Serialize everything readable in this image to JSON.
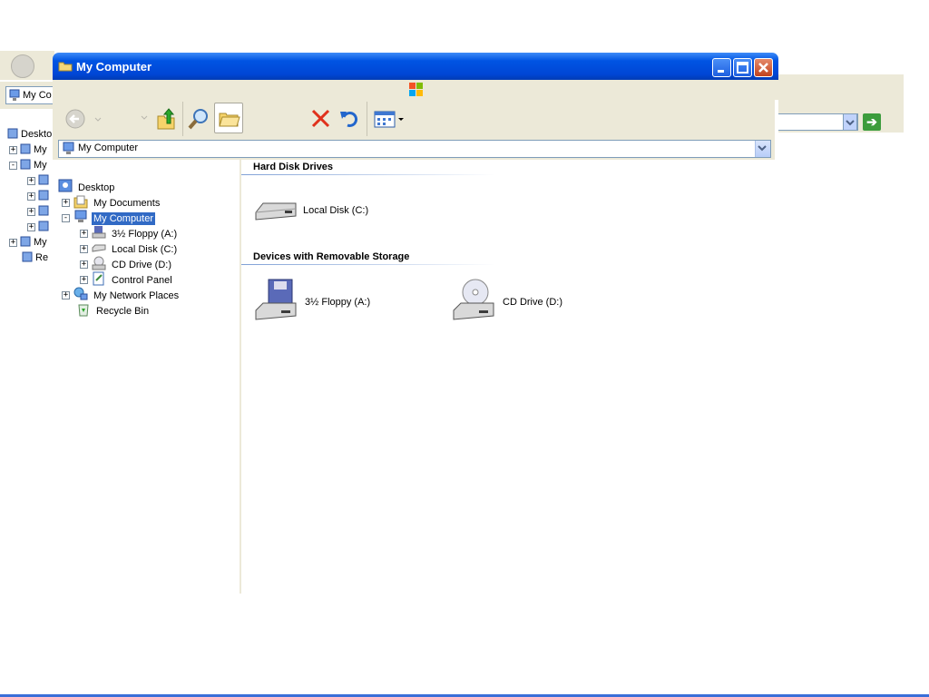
{
  "window": {
    "title": "My Computer",
    "address": "My Computer"
  },
  "ghost": {
    "address_text": "My Co",
    "tree": [
      {
        "label": "Deskto",
        "expander": ""
      },
      {
        "label": "My",
        "expander": "+"
      },
      {
        "label": "My",
        "expander": "-"
      },
      {
        "label": "",
        "expander": "+"
      },
      {
        "label": "",
        "expander": "+"
      },
      {
        "label": "",
        "expander": "+"
      },
      {
        "label": "",
        "expander": "+"
      },
      {
        "label": "My",
        "expander": "+"
      },
      {
        "label": "Re",
        "expander": ""
      }
    ]
  },
  "tree": {
    "desktop": "Desktop",
    "my_documents": "My Documents",
    "my_computer": "My Computer",
    "floppy": "3½ Floppy (A:)",
    "local_disk": "Local Disk (C:)",
    "cd_drive": "CD Drive (D:)",
    "control_panel": "Control Panel",
    "network": "My Network Places",
    "recycle": "Recycle Bin"
  },
  "content": {
    "group_hdd": "Hard Disk Drives",
    "group_removable": "Devices with Removable Storage",
    "local_disk": "Local Disk (C:)",
    "floppy": "3½ Floppy (A:)",
    "cd_drive": "CD Drive (D:)"
  },
  "icons": {
    "back": "back-arrow-icon",
    "forward": "forward-arrow-icon",
    "up": "folder-up-icon",
    "search": "search-icon",
    "folders": "folders-icon",
    "delete": "delete-icon",
    "undo": "undo-icon",
    "views": "views-icon",
    "go": "go-arrow-icon"
  },
  "colors": {
    "title_bar": "#0054e3",
    "selection": "#316ac5",
    "chrome": "#ece9d8"
  }
}
